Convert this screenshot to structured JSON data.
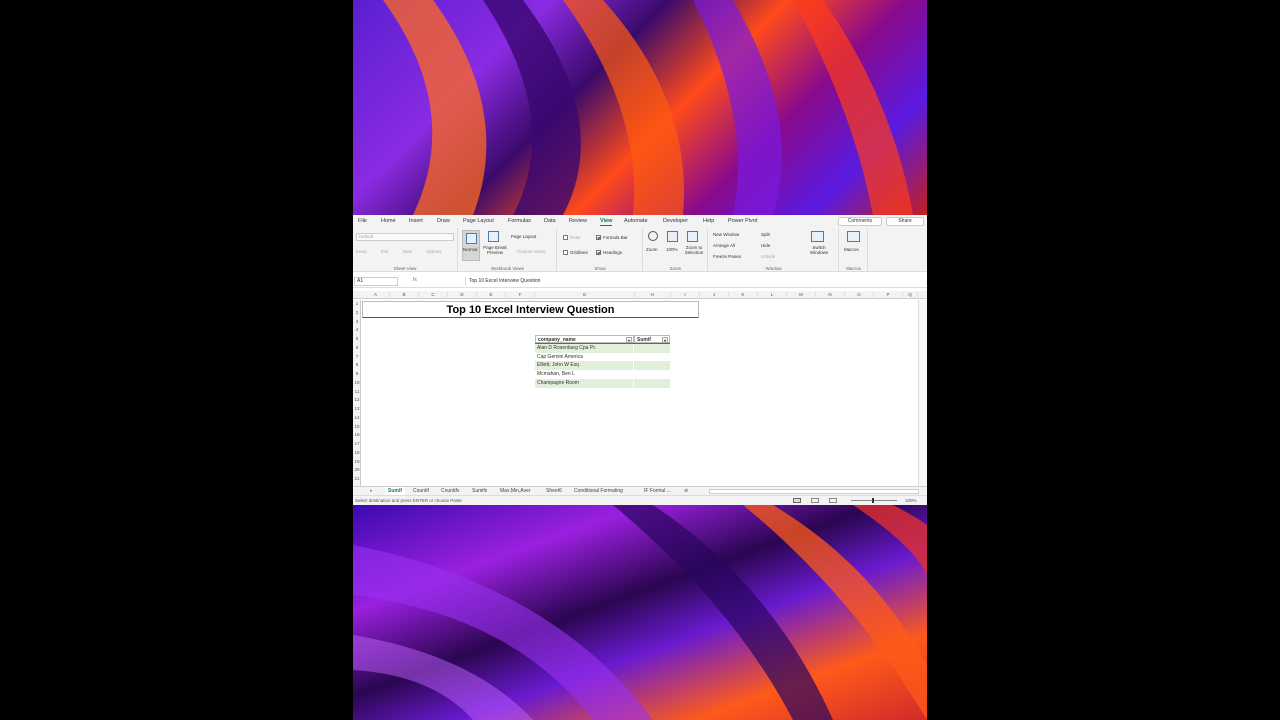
{
  "menu": {
    "tabs": [
      "File",
      "Home",
      "Insert",
      "Draw",
      "Page Layout",
      "Formulas",
      "Data",
      "Review",
      "View",
      "Automate",
      "Developer",
      "Help",
      "Power Pivot"
    ],
    "active_tab": "View",
    "comments_label": "Comments",
    "share_label": "Share"
  },
  "ribbon": {
    "sheet_view": {
      "label": "Sheet View",
      "dropdown_value": "Default",
      "keep": "Keep",
      "exit": "Exit",
      "new": "New",
      "options": "Options"
    },
    "workbook_views": {
      "label": "Workbook Views",
      "normal": "Normal",
      "page_break_preview": "Page Break Preview",
      "page_layout": "Page Layout",
      "custom_views": "Custom Views"
    },
    "show": {
      "label": "Show",
      "ruler": "Ruler",
      "formula_bar": "Formula Bar",
      "gridlines": "Gridlines",
      "headings": "Headings"
    },
    "zoom": {
      "label": "Zoom",
      "zoom": "Zoom",
      "hundred": "100%",
      "zoom_to_selection": "Zoom to Selection"
    },
    "window": {
      "label": "Window",
      "new_window": "New Window",
      "arrange_all": "Arrange All",
      "freeze_panes": "Freeze Panes",
      "split": "Split",
      "hide": "Hide",
      "unhide": "Unhide",
      "switch_windows": "Switch Windows"
    },
    "macros": {
      "label": "Macros",
      "macros": "Macros"
    }
  },
  "formula_bar": {
    "name_box": "A1",
    "fx": "fx",
    "content": "Top 10 Excel Interview Question"
  },
  "columns": [
    "A",
    "B",
    "C",
    "D",
    "E",
    "F",
    "G",
    "H",
    "I",
    "J",
    "K",
    "L",
    "M",
    "N",
    "O",
    "P",
    "Q"
  ],
  "rows": [
    "1",
    "2",
    "3",
    "4",
    "5",
    "6",
    "7",
    "8",
    "9",
    "10",
    "11",
    "12",
    "13",
    "14",
    "15",
    "16",
    "17",
    "18",
    "19",
    "20",
    "21"
  ],
  "sheet": {
    "title": "Top 10 Excel Interview Question",
    "table": {
      "headers": [
        "company_name",
        "Sumif"
      ],
      "rows": [
        [
          "Alan D Rosenburg Cpa Pc",
          ""
        ],
        [
          "Cap Gemini America",
          ""
        ],
        [
          "Elliott, John W Esq",
          ""
        ],
        [
          "Mcmahan, Ben L",
          ""
        ],
        [
          "Champagne Room",
          ""
        ]
      ]
    }
  },
  "sheet_tabs": [
    "Sumif",
    "Countif",
    "Countifs",
    "Sumifs",
    "Max,Min,Aver",
    "Sheet6",
    "Conditional Formating",
    "IF Formul ..."
  ],
  "active_sheet": "Sumif",
  "status": {
    "text": "Select destination and press ENTER or choose Paste",
    "zoom": "100%"
  },
  "colors": {
    "accent": "#107c41",
    "table_stripe": "#e2efda"
  }
}
